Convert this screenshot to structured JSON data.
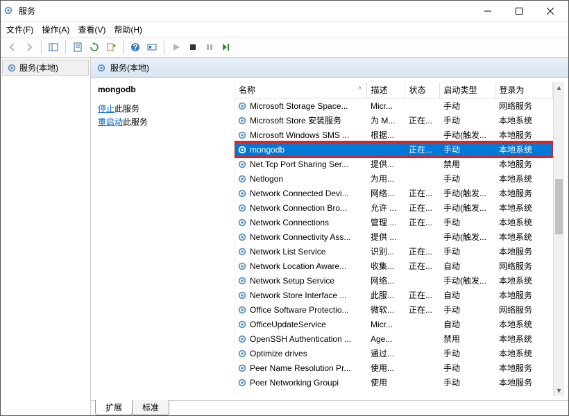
{
  "window": {
    "title": "服务"
  },
  "menu": {
    "file": "文件(F)",
    "action": "操作(A)",
    "view": "查看(V)",
    "help": "帮助(H)"
  },
  "tree": {
    "root": "服务(本地)"
  },
  "panel_header": "服务(本地)",
  "detail": {
    "name": "mongodb",
    "stop_link": "停止",
    "stop_suffix": "此服务",
    "restart_link": "重启动",
    "restart_suffix": "此服务"
  },
  "columns": {
    "name": "名称",
    "desc": "描述",
    "status": "状态",
    "startup": "启动类型",
    "logon": "登录为"
  },
  "services": [
    {
      "name": "Microsoft Storage Space...",
      "desc": "Micr...",
      "status": "",
      "startup": "手动",
      "logon": "网络服务"
    },
    {
      "name": "Microsoft Store 安装服务",
      "desc": "为 M...",
      "status": "正在...",
      "startup": "手动",
      "logon": "本地系统"
    },
    {
      "name": "Microsoft Windows SMS ...",
      "desc": "根据...",
      "status": "",
      "startup": "手动(触发...",
      "logon": "本地服务"
    },
    {
      "name": "mongodb",
      "desc": "",
      "status": "正在...",
      "startup": "手动",
      "logon": "本地系统",
      "selected": true,
      "hl": true
    },
    {
      "name": "Net.Tcp Port Sharing Ser...",
      "desc": "提供...",
      "status": "",
      "startup": "禁用",
      "logon": "本地服务"
    },
    {
      "name": "Netlogon",
      "desc": "为用...",
      "status": "",
      "startup": "手动",
      "logon": "本地系统"
    },
    {
      "name": "Network Connected Devi...",
      "desc": "网络...",
      "status": "正在...",
      "startup": "手动(触发...",
      "logon": "本地服务"
    },
    {
      "name": "Network Connection Bro...",
      "desc": "允许 ...",
      "status": "正在...",
      "startup": "手动(触发...",
      "logon": "本地系统"
    },
    {
      "name": "Network Connections",
      "desc": "管理 ...",
      "status": "正在...",
      "startup": "手动",
      "logon": "本地系统"
    },
    {
      "name": "Network Connectivity Ass...",
      "desc": "提供 ...",
      "status": "",
      "startup": "手动(触发...",
      "logon": "本地系统"
    },
    {
      "name": "Network List Service",
      "desc": "识别...",
      "status": "正在...",
      "startup": "手动",
      "logon": "本地服务"
    },
    {
      "name": "Network Location Aware...",
      "desc": "收集...",
      "status": "正在...",
      "startup": "自动",
      "logon": "网络服务"
    },
    {
      "name": "Network Setup Service",
      "desc": "网络...",
      "status": "",
      "startup": "手动(触发...",
      "logon": "本地系统"
    },
    {
      "name": "Network Store Interface ...",
      "desc": "此服...",
      "status": "正在...",
      "startup": "自动",
      "logon": "本地服务"
    },
    {
      "name": "Office Software Protectio...",
      "desc": "微软...",
      "status": "正在...",
      "startup": "手动",
      "logon": "网络服务"
    },
    {
      "name": "OfficeUpdateService",
      "desc": "Micr...",
      "status": "",
      "startup": "自动",
      "logon": "本地系统"
    },
    {
      "name": "OpenSSH Authentication ...",
      "desc": "Age...",
      "status": "",
      "startup": "禁用",
      "logon": "本地系统"
    },
    {
      "name": "Optimize drives",
      "desc": "通过...",
      "status": "",
      "startup": "手动",
      "logon": "本地系统"
    },
    {
      "name": "Peer Name Resolution Pr...",
      "desc": "使用...",
      "status": "",
      "startup": "手动",
      "logon": "本地服务"
    },
    {
      "name": "Peer Networking Groupi",
      "desc": "使用",
      "status": "",
      "startup": "手动",
      "logon": "本地服务"
    }
  ],
  "tabs": {
    "extended": "扩展",
    "standard": "标准"
  }
}
